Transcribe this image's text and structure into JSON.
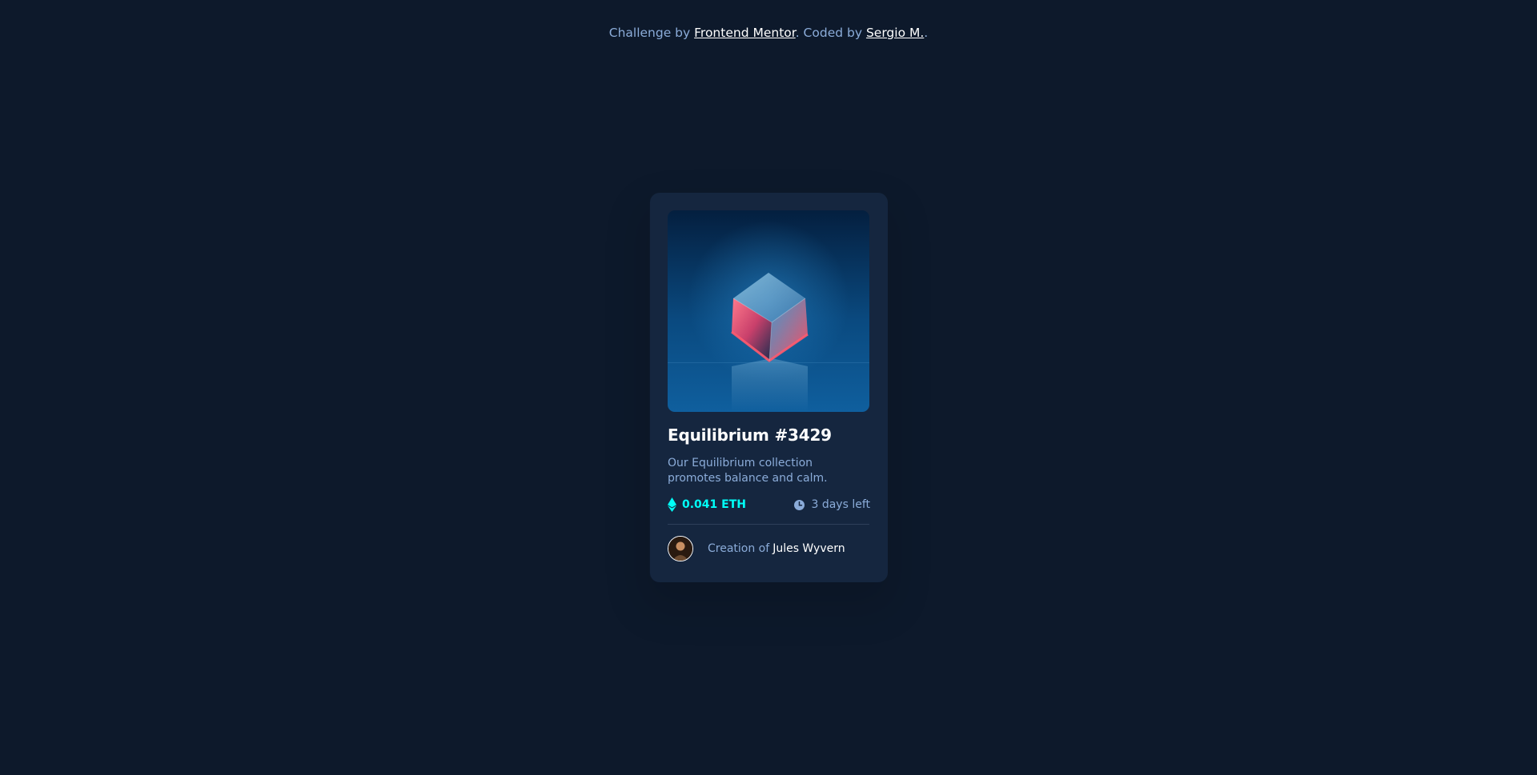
{
  "attribution": {
    "prefix": "Challenge by ",
    "challenge_link": "Frontend Mentor",
    "middle": ". Coded by ",
    "author_link": "Sergio M.",
    "suffix": "."
  },
  "card": {
    "image_icon": "crystal-cube-image",
    "title": "Equilibrium #3429",
    "description": "Our Equilibrium collection promotes balance and calm.",
    "price": "0.041 ETH",
    "price_icon": "ethereum-icon",
    "time_left": "3 days left",
    "time_icon": "clock-icon",
    "creator_prefix": "Creation of",
    "creator_name": "Jules Wyvern"
  },
  "colors": {
    "background": "#0d192b",
    "card": "#15263f",
    "accent_cyan": "#00fff8",
    "soft_blue": "#8bacd9",
    "white": "#ffffff"
  }
}
